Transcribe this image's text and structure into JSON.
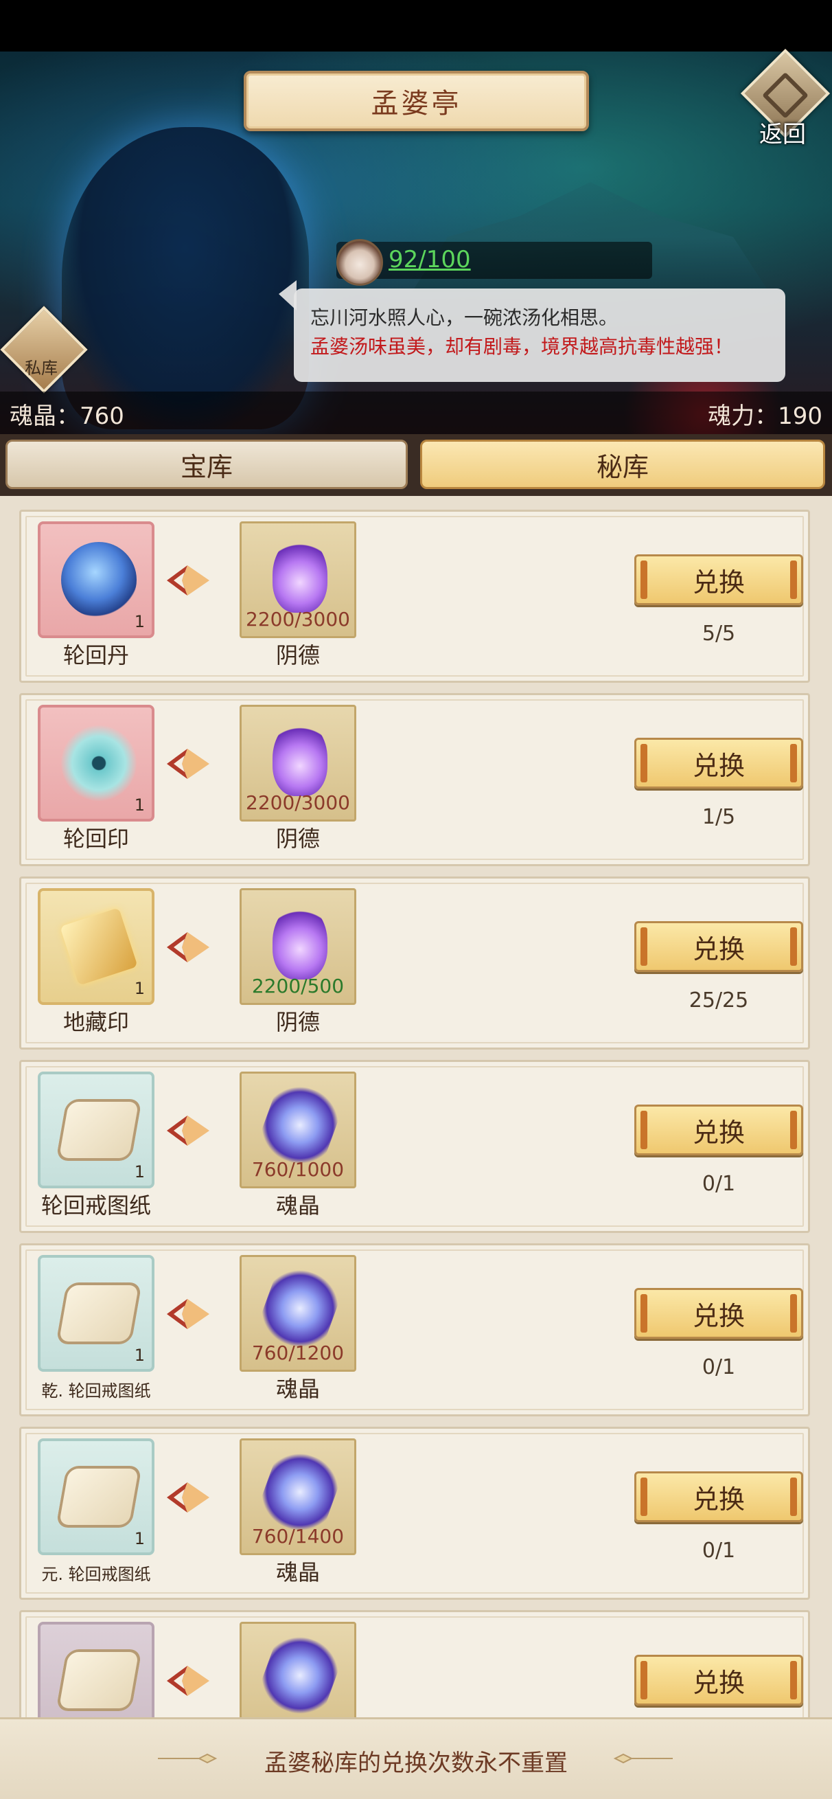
{
  "header": {
    "title": "孟婆亭",
    "back_label": "返回"
  },
  "potion": {
    "value": "92/100"
  },
  "dialog": {
    "line1": "忘川河水照人心，一碗浓汤化相思。",
    "line2": "孟婆汤味虽美，却有剧毒，境界越高抗毒性越强！"
  },
  "private_label": "私库",
  "stats": {
    "soul_crystal": "魂晶：760",
    "soul_power": "魂力：190"
  },
  "tabs": [
    {
      "label": "宝库",
      "active": false
    },
    {
      "label": "秘库",
      "active": true
    }
  ],
  "button_label": "兑换",
  "items": [
    {
      "name": "轮回丹",
      "qty": "1",
      "box": "pink",
      "art": "orb-icon",
      "cost_name": "阴德",
      "cost_count": "2200/3000",
      "cost_ok": false,
      "cost_art": "purple-flame-icon",
      "limit": "5/5"
    },
    {
      "name": "轮回印",
      "qty": "1",
      "box": "pink",
      "art": "seal-icon",
      "cost_name": "阴德",
      "cost_count": "2200/3000",
      "cost_ok": false,
      "cost_art": "purple-flame-icon",
      "limit": "1/5"
    },
    {
      "name": "地藏印",
      "qty": "1",
      "box": "gold",
      "art": "book-icon",
      "cost_name": "阴德",
      "cost_count": "2200/500",
      "cost_ok": true,
      "cost_art": "purple-flame-icon",
      "limit": "25/25"
    },
    {
      "name": "轮回戒图纸",
      "qty": "1",
      "box": "teal",
      "art": "scroll-icon",
      "cost_name": "魂晶",
      "cost_count": "760/1000",
      "cost_ok": false,
      "cost_art": "crystal-icon",
      "limit": "0/1"
    },
    {
      "name": "乾. 轮回戒图纸",
      "qty": "1",
      "box": "teal",
      "art": "scroll-icon",
      "cost_name": "魂晶",
      "cost_count": "760/1200",
      "cost_ok": false,
      "cost_art": "crystal-icon",
      "limit": "0/1"
    },
    {
      "name": "元. 轮回戒图纸",
      "qty": "1",
      "box": "teal",
      "art": "scroll-icon",
      "cost_name": "魂晶",
      "cost_count": "760/1400",
      "cost_ok": false,
      "cost_art": "crystal-icon",
      "limit": "0/1"
    },
    {
      "name": "",
      "qty": "",
      "box": "mauve",
      "art": "scroll-icon",
      "cost_name": "",
      "cost_count": "",
      "cost_ok": false,
      "cost_art": "crystal-icon",
      "limit": ""
    }
  ],
  "footer": {
    "text": "孟婆秘库的兑换次数永不重置"
  },
  "colors": {
    "accent": "#efc86f",
    "warning_red": "#c2191b",
    "ok_green": "#2b7a2b"
  }
}
